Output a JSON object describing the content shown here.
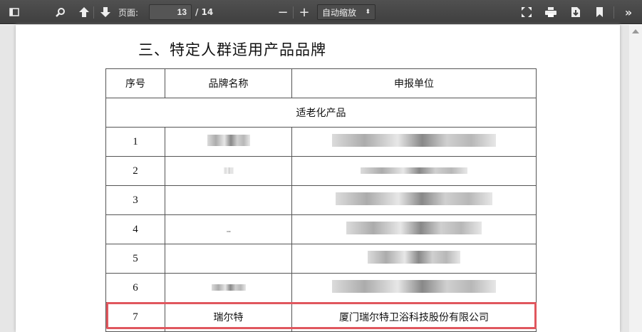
{
  "toolbar": {
    "page_label": "页面:",
    "page_current": "13",
    "page_total": "/ 14",
    "zoom_value": "自动缩放"
  },
  "document": {
    "title": "三、特定人群适用产品品牌",
    "headers": [
      "序号",
      "品牌名称",
      "申报单位"
    ],
    "category": "适老化产品",
    "rows": [
      {
        "no": "1",
        "brand": "",
        "company": ""
      },
      {
        "no": "2",
        "brand": "",
        "company": ""
      },
      {
        "no": "3",
        "brand": "",
        "company": ""
      },
      {
        "no": "4",
        "brand": "",
        "company": ""
      },
      {
        "no": "5",
        "brand": "",
        "company": ""
      },
      {
        "no": "6",
        "brand": "",
        "company": ""
      },
      {
        "no": "7",
        "brand": "瑞尔特",
        "company": "厦门瑞尔特卫浴科技股份有限公司"
      }
    ],
    "highlight_color": "#e0575e"
  }
}
